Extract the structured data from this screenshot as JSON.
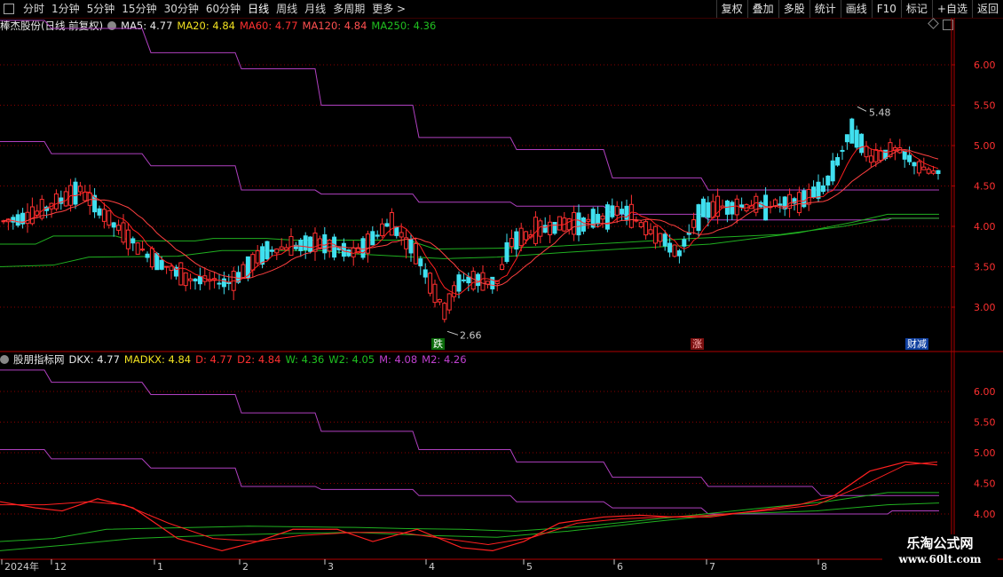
{
  "toolbar": {
    "periods": [
      "分时",
      "1分钟",
      "5分钟",
      "15分钟",
      "30分钟",
      "60分钟",
      "日线",
      "周线",
      "月线",
      "多周期",
      "更多 >"
    ],
    "active_period": "日线",
    "right_buttons": [
      "复权",
      "叠加",
      "多股",
      "统计",
      "画线",
      "F10",
      "标记",
      "+自选",
      "返回"
    ]
  },
  "main_panel": {
    "stock_label": "棒杰股份(日线 前复权)",
    "ma": [
      {
        "label": "MA5: 4.77",
        "color": "#e8e8e8"
      },
      {
        "label": "MA20: 4.84",
        "color": "#f0e020"
      },
      {
        "label": "MA60: 4.77",
        "color": "#ff3030"
      },
      {
        "label": "MA120: 4.84",
        "color": "#ff5050"
      },
      {
        "label": "MA250: 4.36",
        "color": "#20c020"
      }
    ],
    "y_ticks": [
      "6.00",
      "5.50",
      "5.00",
      "4.50",
      "4.00",
      "3.50",
      "3.00"
    ],
    "high_mark": "5.48",
    "low_mark": "2.66",
    "tags": [
      "跌",
      "涨",
      "财减"
    ]
  },
  "sub_panel": {
    "indicator_name": "股朋指标网",
    "values": [
      {
        "label": "DKX: 4.77",
        "color": "#e8e8e8"
      },
      {
        "label": "MADKX: 4.84",
        "color": "#f0e020"
      },
      {
        "label": "D: 4.77",
        "color": "#ff3030"
      },
      {
        "label": "D2: 4.84",
        "color": "#ff3030"
      },
      {
        "label": "W: 4.36",
        "color": "#20c020"
      },
      {
        "label": "W2: 4.05",
        "color": "#20c020"
      },
      {
        "label": "M: 4.08",
        "color": "#c040d0"
      },
      {
        "label": "M2: 4.26",
        "color": "#c040d0"
      }
    ],
    "y_ticks": [
      "6.00",
      "5.50",
      "5.00",
      "4.50",
      "4.00"
    ]
  },
  "x_axis": {
    "labels": [
      "2024年",
      "12",
      "1",
      "2",
      "3",
      "4",
      "5",
      "6",
      "7",
      "8"
    ]
  },
  "watermark": {
    "line1": "乐淘公式网",
    "line2": "www.60lt.com"
  },
  "colors": {
    "up": "#ff3030",
    "down": "#40e0f0",
    "grid": "#8a0000",
    "axis": "#b00000",
    "ma_red": "#ff2020",
    "purple": "#b040c0",
    "green": "#20b020"
  }
}
